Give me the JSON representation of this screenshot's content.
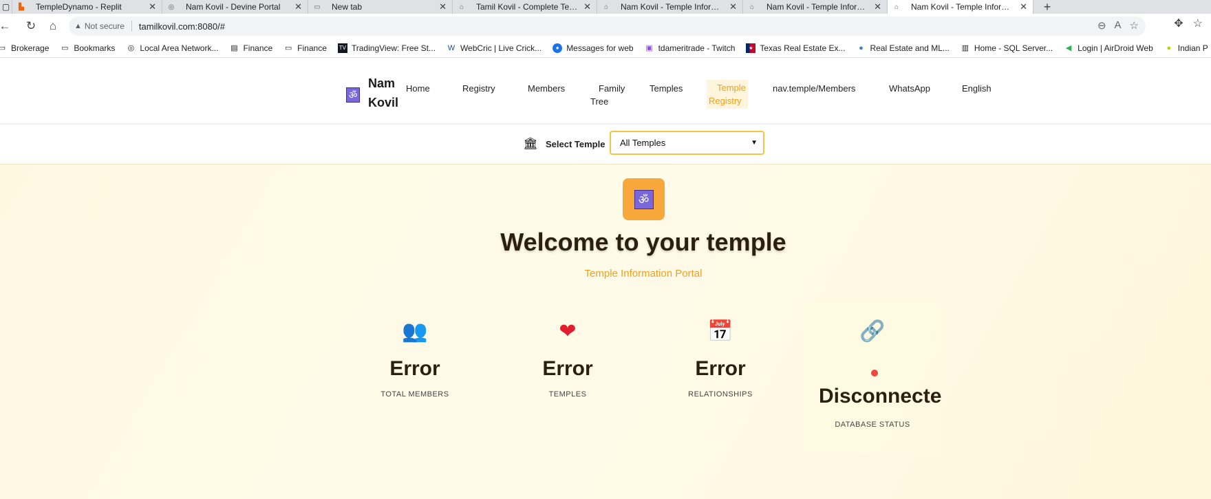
{
  "browser": {
    "tabs": [
      {
        "label": "TempleDynamo - Replit",
        "icon": "replit-icon"
      },
      {
        "label": "Nam Kovil - Devine Portal",
        "icon": "globe-icon"
      },
      {
        "label": "New tab",
        "icon": "newtab-icon"
      },
      {
        "label": "Tamil Kovil - Complete Temple M",
        "icon": "temple-icon"
      },
      {
        "label": "Nam Kovil - Temple Information",
        "icon": "temple-icon"
      },
      {
        "label": "Nam Kovil - Temple Information",
        "icon": "temple-icon"
      },
      {
        "label": "Nam Kovil - Temple Information",
        "icon": "temple-icon"
      }
    ],
    "security_label": "Not secure",
    "url": "tamilkovil.com:8080/#",
    "bookmarks": [
      {
        "label": "Brokerage",
        "icon": "folder-icon"
      },
      {
        "label": "Bookmarks",
        "icon": "folder-icon"
      },
      {
        "label": "Local Area Network...",
        "icon": "globe-icon"
      },
      {
        "label": "Finance",
        "icon": "finance-icon"
      },
      {
        "label": "Finance",
        "icon": "folder-icon"
      },
      {
        "label": "TradingView: Free St...",
        "icon": "tradingview-icon"
      },
      {
        "label": "WebCric | Live Crick...",
        "icon": "webcric-icon"
      },
      {
        "label": "Messages for web",
        "icon": "messages-icon"
      },
      {
        "label": "tdameritrade - Twitch",
        "icon": "twitch-icon"
      },
      {
        "label": "Texas Real Estate Ex...",
        "icon": "texas-flag-icon"
      },
      {
        "label": "Real Estate and ML...",
        "icon": "realestate-icon"
      },
      {
        "label": "Home - SQL Server...",
        "icon": "chart-icon"
      },
      {
        "label": "Login | AirDroid Web",
        "icon": "airdroid-icon"
      },
      {
        "label": "Indian P",
        "icon": "tennis-ball-icon"
      }
    ]
  },
  "nav": {
    "brand_line1": "Nam",
    "brand_line2": "Kovil",
    "items": [
      {
        "line1": "Home",
        "line2": ""
      },
      {
        "line1": "Registry",
        "line2": ""
      },
      {
        "line1": "Members",
        "line2": ""
      },
      {
        "line1": "Family",
        "line2": "Tree"
      },
      {
        "line1": "Temples",
        "line2": ""
      },
      {
        "line1": "Temple",
        "line2": "Registry"
      },
      {
        "line1": "nav.temple/Members",
        "line2": ""
      },
      {
        "line1": "WhatsApp",
        "line2": ""
      },
      {
        "line1": "English",
        "line2": ""
      }
    ],
    "active_item": "Temple Registry"
  },
  "temple_select": {
    "label": "Select Temple",
    "selected": "All Temples"
  },
  "hero": {
    "title": "Welcome to your temple",
    "subtitle": "Temple Information Portal"
  },
  "stats": [
    {
      "icon": "members-icon",
      "value": "Error",
      "label": "TOTAL MEMBERS"
    },
    {
      "icon": "heart-icon",
      "value": "Error",
      "label": "TEMPLES"
    },
    {
      "icon": "calendar-icon",
      "value": "Error",
      "label": "RELATIONSHIPS"
    },
    {
      "icon": "link-icon",
      "value": "Disconnected",
      "label": "DATABASE STATUS"
    }
  ],
  "colors": {
    "accent": "#f0a020",
    "om_tile": "#f8a83a",
    "om_purple": "#7a67d9",
    "status_dot": "#ef4444",
    "hero_bg": "#fff8e1"
  }
}
